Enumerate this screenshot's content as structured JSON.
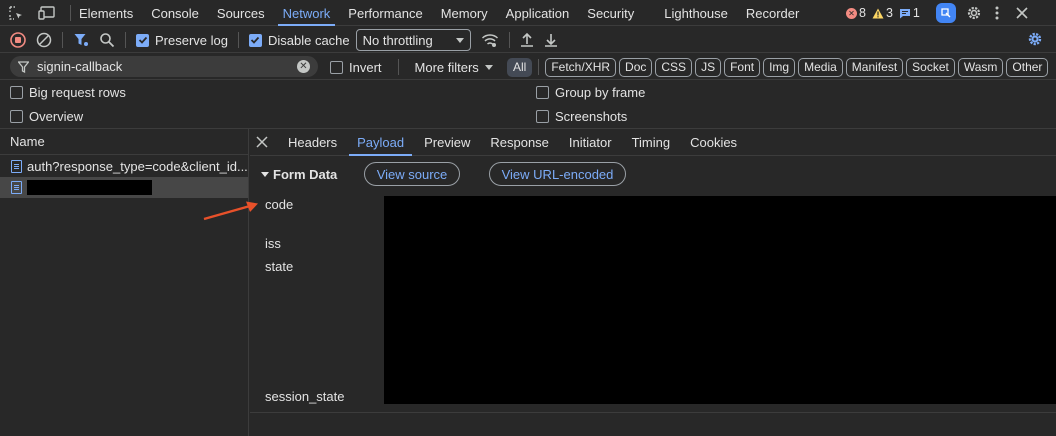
{
  "tabs": [
    "Elements",
    "Console",
    "Sources",
    "Network",
    "Performance",
    "Memory",
    "Application",
    "Security",
    "Lighthouse",
    "Recorder"
  ],
  "issues": {
    "errors": "8",
    "warnings": "3",
    "messages": "1"
  },
  "toolbar": {
    "preserve_log": "Preserve log",
    "disable_cache": "Disable cache",
    "throttling": "No throttling"
  },
  "filter": {
    "value": "signin-callback",
    "invert": "Invert",
    "more_filters": "More filters",
    "chips": [
      "All",
      "Fetch/XHR",
      "Doc",
      "CSS",
      "JS",
      "Font",
      "Img",
      "Media",
      "Manifest",
      "Socket",
      "Wasm",
      "Other"
    ]
  },
  "options": {
    "big_request_rows": "Big request rows",
    "overview": "Overview",
    "group_by_frame": "Group by frame",
    "screenshots": "Screenshots"
  },
  "requests": {
    "header": "Name",
    "items": [
      "auth?response_type=code&client_id..."
    ]
  },
  "detail": {
    "tabs": [
      "Headers",
      "Payload",
      "Preview",
      "Response",
      "Initiator",
      "Timing",
      "Cookies"
    ],
    "section": "Form Data",
    "view_source": "View source",
    "view_url_encoded": "View URL-encoded",
    "keys": [
      "code",
      "iss",
      "state",
      "session_state"
    ]
  },
  "colors": {
    "accent": "#7cacf8",
    "annotation_arrow": "#e8512a",
    "error": "#f28b82",
    "warning": "#fdd663"
  }
}
